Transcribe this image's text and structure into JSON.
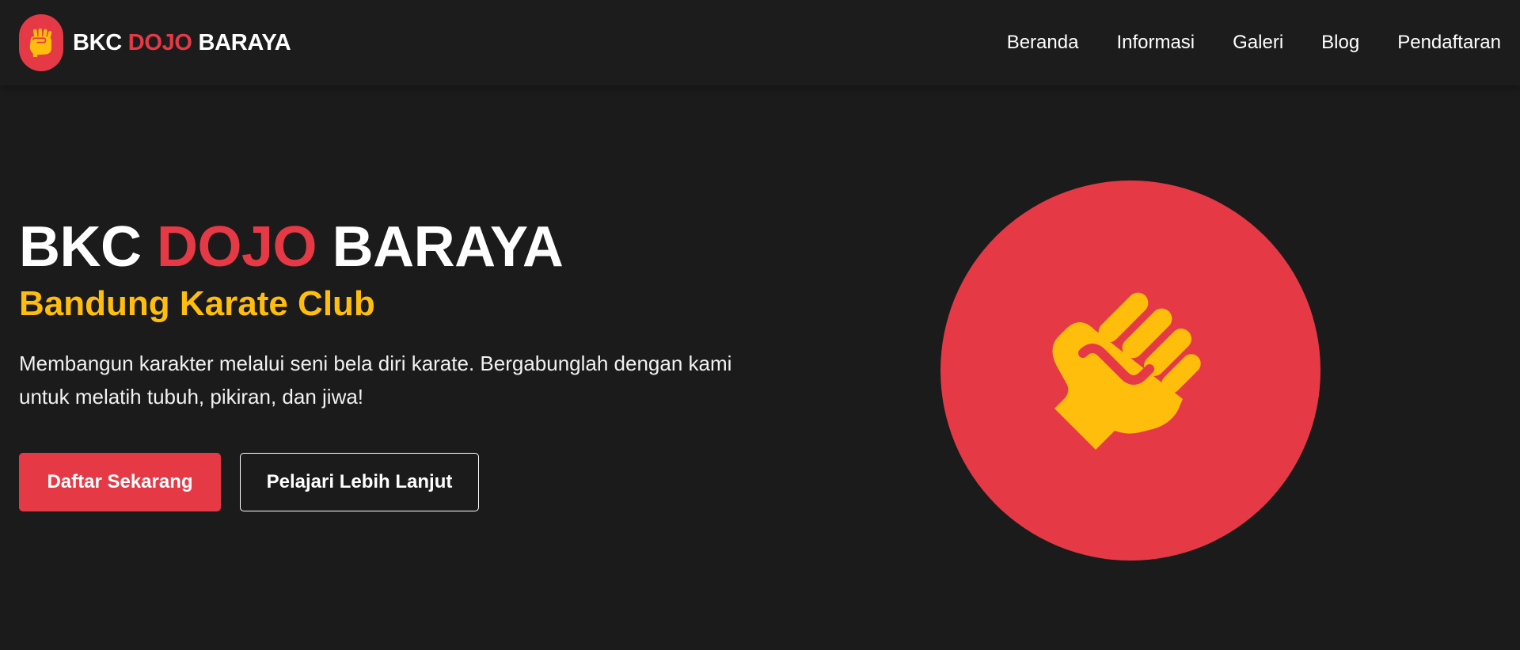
{
  "brand": {
    "name_part1": "BKC",
    "name_part2": "DOJO",
    "name_part3": "BARAYA",
    "logo_icon": "fist-icon"
  },
  "nav": {
    "items": [
      {
        "label": "Beranda"
      },
      {
        "label": "Informasi"
      },
      {
        "label": "Galeri"
      },
      {
        "label": "Blog"
      },
      {
        "label": "Pendaftaran"
      }
    ]
  },
  "hero": {
    "title_part1": "BKC",
    "title_part2": "DOJO",
    "title_part3": "BARAYA",
    "subtitle": "Bandung Karate Club",
    "description": "Membangun karakter melalui seni bela diri karate. Bergabunglah dengan kami untuk melatih tubuh, pikiran, dan jiwa!",
    "primary_button": "Daftar Sekarang",
    "secondary_button": "Pelajari Lebih Lanjut",
    "illustration_icon": "fist-icon"
  },
  "colors": {
    "background": "#1b1b1b",
    "accent_red": "#e63946",
    "accent_yellow": "#ffbe0b",
    "text": "#ffffff"
  }
}
